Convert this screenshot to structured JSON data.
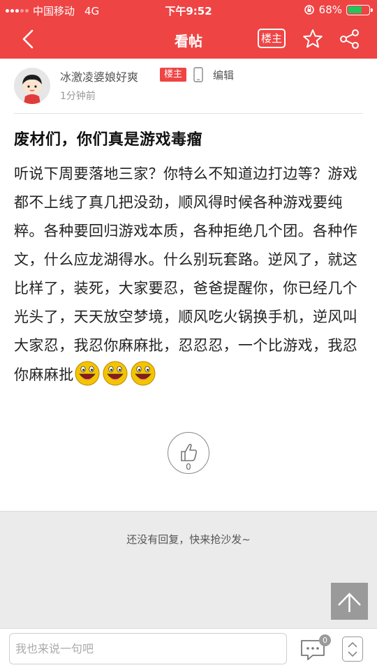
{
  "status_bar": {
    "carrier": "中国移动",
    "network": "4G",
    "time": "下午9:52",
    "battery_percent": "68%",
    "battery_level": 0.68,
    "icons": [
      "signal-icon",
      "rotation-lock-icon",
      "battery-icon"
    ]
  },
  "nav": {
    "title": "看帖",
    "owner_only_label": "楼主",
    "icons": [
      "back-arrow-icon",
      "star-icon",
      "share-icon"
    ]
  },
  "author": {
    "name": "冰激凌婆娘好爽",
    "owner_tag": "楼主",
    "edit_label": "编辑",
    "time": "1分钟前",
    "icons": [
      "avatar",
      "phone-device-icon"
    ]
  },
  "post": {
    "title": "废材们，你们真是游戏毒瘤",
    "body": "听说下周要落地三家？你特么不知道边打边等？游戏都不上线了真几把没劲，顺风得时候各种游戏要纯粹。各种要回归游戏本质，各种拒绝几个团。各种作文，什么应龙湖得水。什么别玩套路。逆风了，就这比样了，装死，大家要忍，爸爸提醒你，你已经几个光头了，天天放空梦境，顺风吃火锅换手机，逆风叫大家忍，我忍你麻麻批，忍忍忍，一个比游戏，我忍你麻麻批",
    "emoji_count": 3,
    "like_count": "0",
    "icons": [
      "laughing-emoji-icon",
      "thumbs-up-icon"
    ]
  },
  "replies": {
    "empty_text": "还没有回复，快来抢沙发~",
    "icons": [
      "scroll-to-top-icon"
    ]
  },
  "bottom_bar": {
    "input_placeholder": "我也来说一句吧",
    "comment_count": "0",
    "icons": [
      "comments-icon",
      "page-nav-icon"
    ]
  },
  "colors": {
    "accent": "#ef4444",
    "battery": "#22c55e",
    "emoji": "#f5c400"
  }
}
